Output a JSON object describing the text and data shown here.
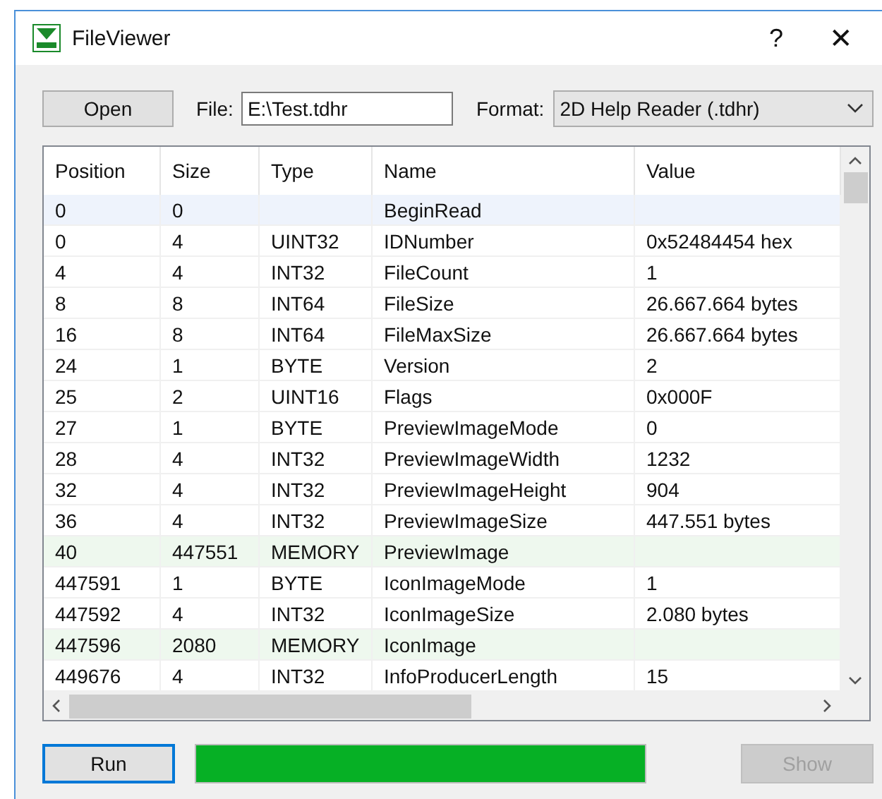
{
  "window": {
    "title": "FileViewer",
    "help": "?",
    "close": "✕"
  },
  "toolbar": {
    "open_button": "Open",
    "file_label": "File:",
    "file_value": "E:\\Test.tdhr",
    "format_label": "Format:",
    "format_value": "2D Help Reader (.tdhr)"
  },
  "table": {
    "columns": [
      "Position",
      "Size",
      "Type",
      "Name",
      "Value"
    ],
    "rows": [
      {
        "cells": [
          "0",
          "0",
          "",
          "BeginRead",
          ""
        ],
        "selected": true,
        "kind": "field"
      },
      {
        "cells": [
          "0",
          "4",
          "UINT32",
          "IDNumber",
          "0x52484454 hex"
        ],
        "selected": false,
        "kind": "field"
      },
      {
        "cells": [
          "4",
          "4",
          "INT32",
          "FileCount",
          "1"
        ],
        "selected": false,
        "kind": "field"
      },
      {
        "cells": [
          "8",
          "8",
          "INT64",
          "FileSize",
          "26.667.664 bytes"
        ],
        "selected": false,
        "kind": "field"
      },
      {
        "cells": [
          "16",
          "8",
          "INT64",
          "FileMaxSize",
          "26.667.664 bytes"
        ],
        "selected": false,
        "kind": "field"
      },
      {
        "cells": [
          "24",
          "1",
          "BYTE",
          "Version",
          "2"
        ],
        "selected": false,
        "kind": "field"
      },
      {
        "cells": [
          "25",
          "2",
          "UINT16",
          "Flags",
          "0x000F"
        ],
        "selected": false,
        "kind": "field"
      },
      {
        "cells": [
          "27",
          "1",
          "BYTE",
          "PreviewImageMode",
          "0"
        ],
        "selected": false,
        "kind": "field"
      },
      {
        "cells": [
          "28",
          "4",
          "INT32",
          "PreviewImageWidth",
          "1232"
        ],
        "selected": false,
        "kind": "field"
      },
      {
        "cells": [
          "32",
          "4",
          "INT32",
          "PreviewImageHeight",
          "904"
        ],
        "selected": false,
        "kind": "field"
      },
      {
        "cells": [
          "36",
          "4",
          "INT32",
          "PreviewImageSize",
          "447.551 bytes"
        ],
        "selected": false,
        "kind": "field"
      },
      {
        "cells": [
          "40",
          "447551",
          "MEMORY",
          "PreviewImage",
          ""
        ],
        "selected": false,
        "kind": "memory"
      },
      {
        "cells": [
          "447591",
          "1",
          "BYTE",
          "IconImageMode",
          "1"
        ],
        "selected": false,
        "kind": "field"
      },
      {
        "cells": [
          "447592",
          "4",
          "INT32",
          "IconImageSize",
          "2.080 bytes"
        ],
        "selected": false,
        "kind": "field"
      },
      {
        "cells": [
          "447596",
          "2080",
          "MEMORY",
          "IconImage",
          ""
        ],
        "selected": false,
        "kind": "memory"
      },
      {
        "cells": [
          "449676",
          "4",
          "INT32",
          "InfoProducerLength",
          "15"
        ],
        "selected": false,
        "kind": "field"
      }
    ]
  },
  "footer": {
    "run_button": "Run",
    "run_focused": true,
    "progress": {
      "level": 1
    },
    "show_button": "Show",
    "show_disabled": true
  }
}
